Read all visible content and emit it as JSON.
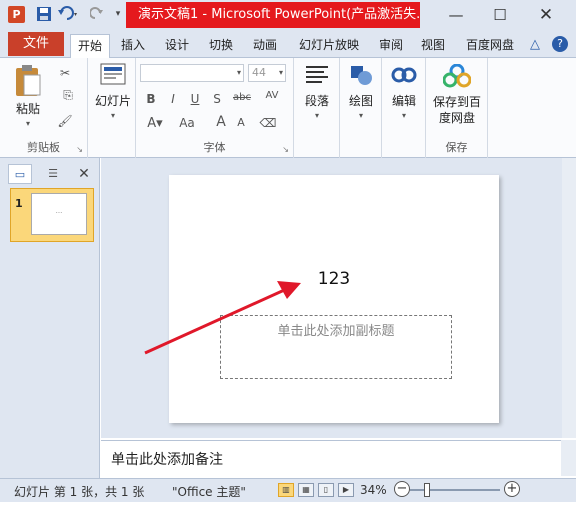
{
  "titlebar": {
    "title": "演示文稿1 - Microsoft PowerPoint(产品激活失...",
    "app_icon": "P",
    "minimize": "—",
    "maximize": "☐",
    "close": "✕"
  },
  "tabs": {
    "file": "文件",
    "items": [
      "开始",
      "插入",
      "设计",
      "切换",
      "动画",
      "幻灯片放映",
      "审阅",
      "视图",
      "百度网盘"
    ],
    "active": "开始"
  },
  "ribbon": {
    "clipboard": {
      "paste": "粘贴",
      "group": "剪贴板"
    },
    "slides": {
      "new_slide": "幻灯片",
      "group": ""
    },
    "font": {
      "group": "字体",
      "font_name": "",
      "font_size": "44",
      "bold": "B",
      "italic": "I",
      "underline": "U",
      "shadow": "S",
      "strike": "abc",
      "spacing": "AV",
      "case": "Aa",
      "grow": "A",
      "shrink": "A"
    },
    "paragraph": {
      "label": "段落"
    },
    "drawing": {
      "label": "绘图"
    },
    "editing": {
      "label": "编辑"
    },
    "save": {
      "label": "保存到百度网盘",
      "group": "保存"
    }
  },
  "leftpane": {
    "slide_number": "1",
    "thumbnail_text": "..."
  },
  "slide": {
    "title": "123",
    "subtitle_placeholder": "单击此处添加副标题"
  },
  "notes": {
    "placeholder": "单击此处添加备注"
  },
  "statusbar": {
    "slide_info": "幻灯片 第 1 张，共 1 张",
    "theme": "\"Office 主题\"",
    "zoom": "34%"
  },
  "colors": {
    "title_highlight": "#e5191d",
    "file_tab": "#c9402a",
    "arrow": "#e0182a"
  }
}
